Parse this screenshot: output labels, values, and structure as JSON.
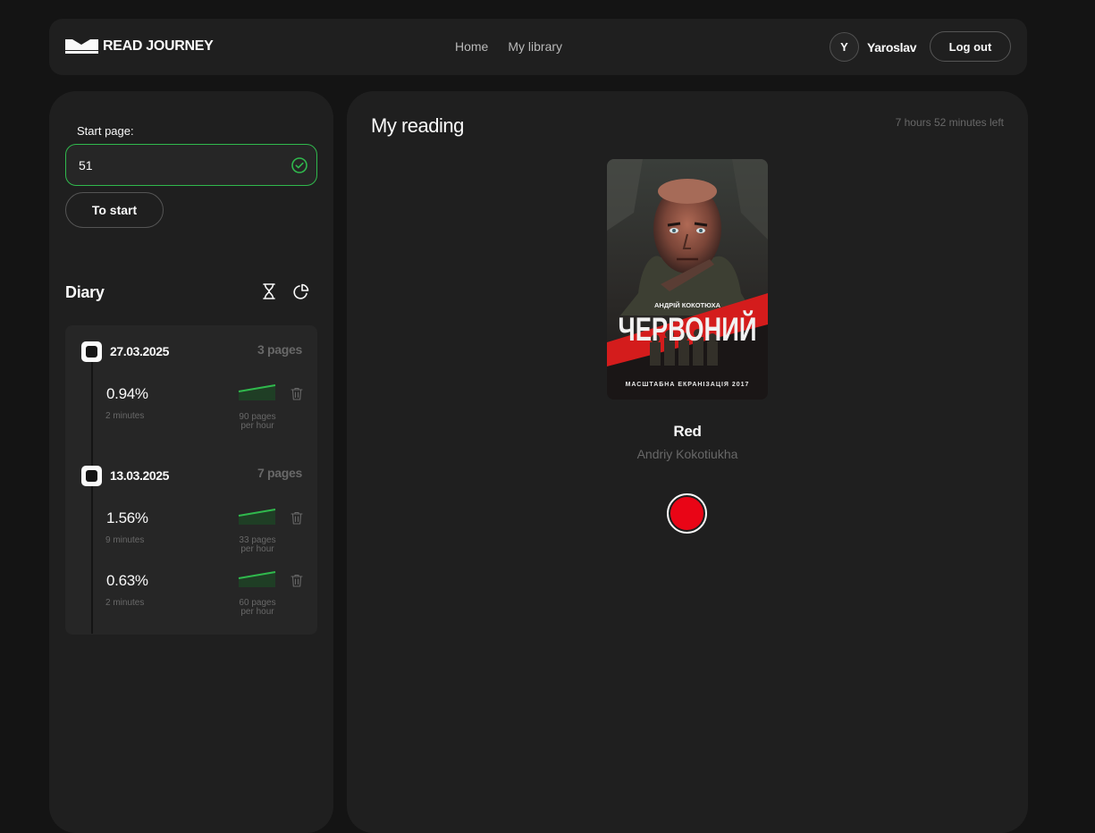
{
  "header": {
    "logo_text": "READ JOURNEY",
    "nav": [
      {
        "label": "Home"
      },
      {
        "label": "My library"
      }
    ],
    "user": {
      "initial": "Y",
      "name": "Yaroslav"
    },
    "logout_label": "Log out"
  },
  "sidebar": {
    "start_page_label": "Start page:",
    "start_page_value": "51",
    "to_start_label": "To start",
    "diary_title": "Diary",
    "days": [
      {
        "date": "27.03.2025",
        "pages": "3 pages",
        "entries": [
          {
            "percent": "0.94%",
            "time": "2 minutes",
            "speed_line1": "90 pages",
            "speed_line2": "per hour"
          }
        ]
      },
      {
        "date": "13.03.2025",
        "pages": "7 pages",
        "entries": [
          {
            "percent": "1.56%",
            "time": "9 minutes",
            "speed_line1": "33 pages",
            "speed_line2": "per hour"
          },
          {
            "percent": "0.63%",
            "time": "2 minutes",
            "speed_line1": "60 pages",
            "speed_line2": "per hour"
          }
        ]
      }
    ]
  },
  "main": {
    "title": "My reading",
    "time_left": "7 hours 52 minutes left",
    "book": {
      "title": "Red",
      "author": "Andriy Kokotiukha",
      "cover_author": "АНДРІЙ КОКОТЮХА",
      "cover_title": "ЧЕРВОНИЙ",
      "cover_tagline": "МАСШТАБНА ЕКРАНІЗАЦІЯ 2017"
    }
  },
  "colors": {
    "background": "#141414",
    "panel": "#1f1f1f",
    "card": "#262626",
    "accent_green": "#30b94d",
    "record_red": "#e90516",
    "muted": "#686868"
  },
  "icons": [
    "logo-book-icon",
    "check-circle-icon",
    "hourglass-icon",
    "pie-chart-icon",
    "trash-icon",
    "record-icon"
  ]
}
